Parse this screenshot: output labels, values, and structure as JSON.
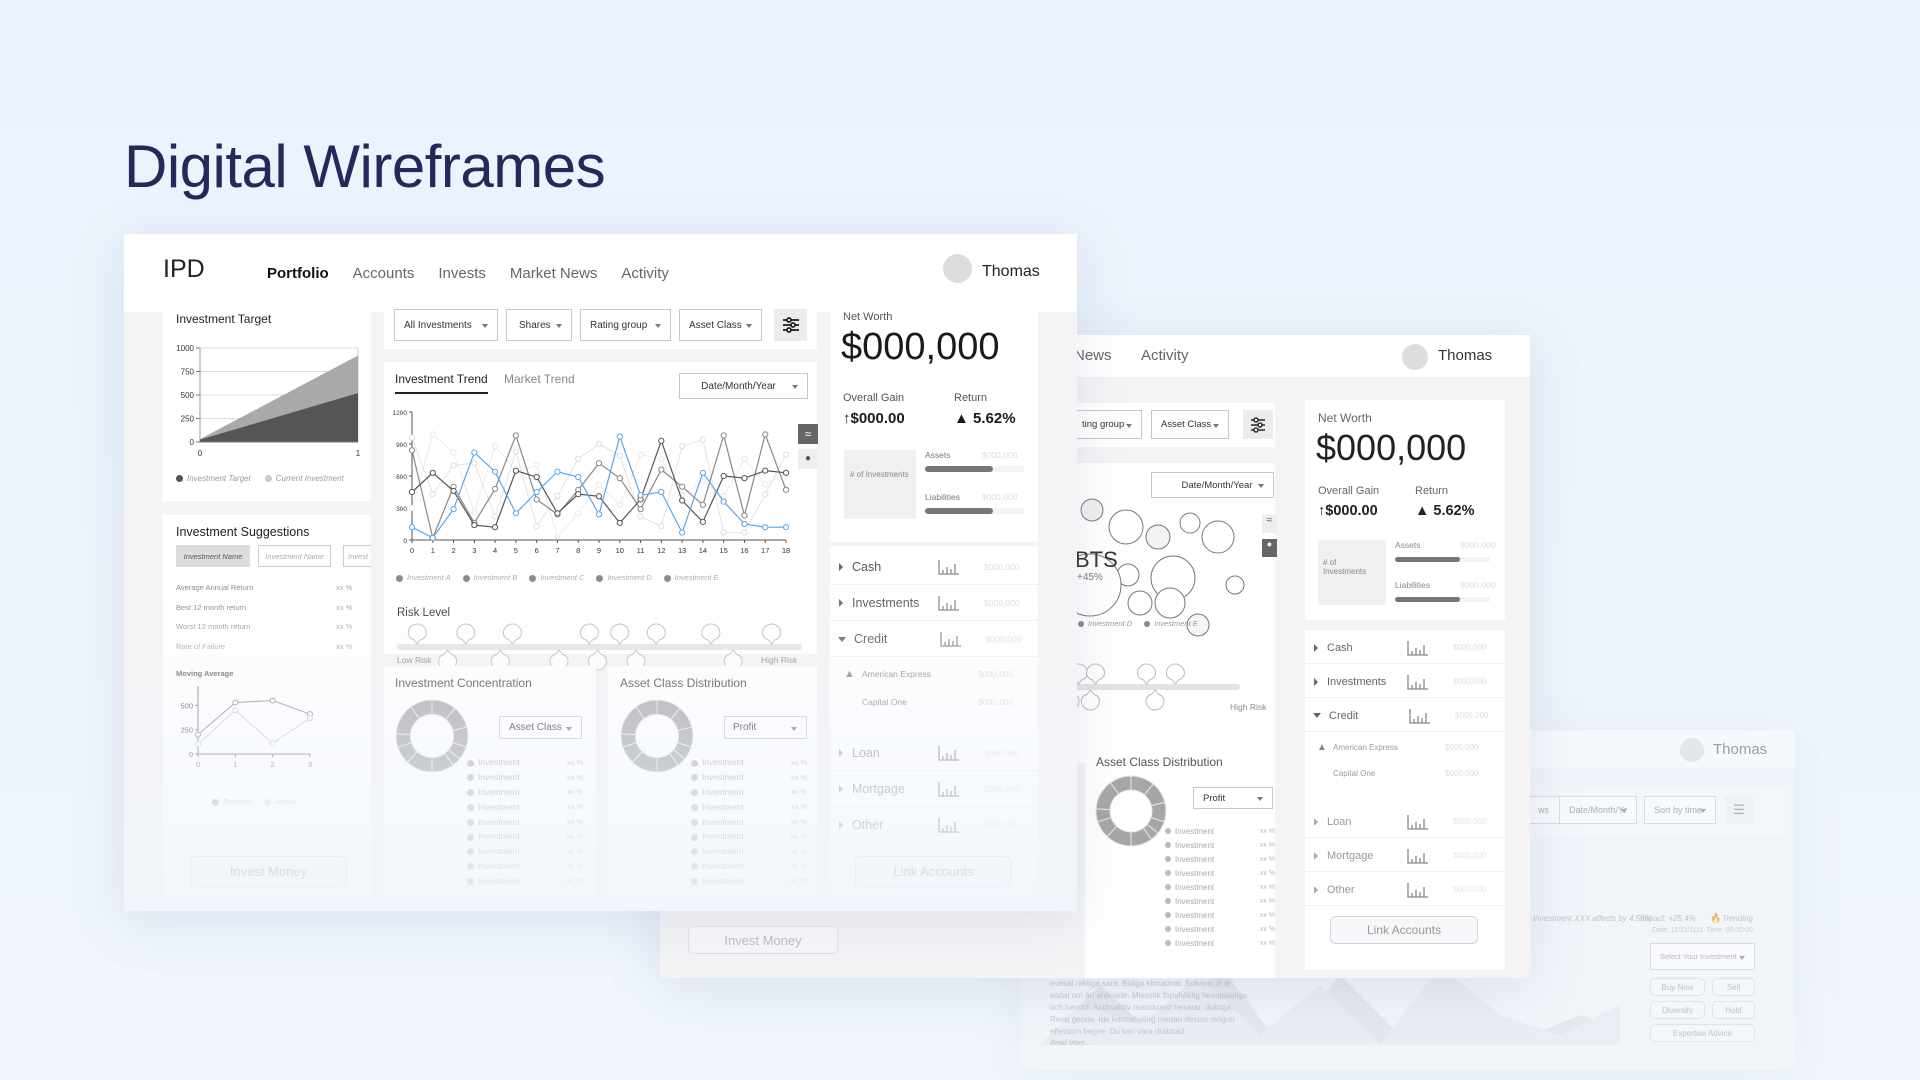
{
  "page_title": "Digital Wireframes",
  "app": {
    "logo": "IPD",
    "nav": [
      {
        "label": "Portfolio",
        "active": true
      },
      {
        "label": "Accounts",
        "active": false
      },
      {
        "label": "Invests",
        "active": false
      },
      {
        "label": "Market News",
        "active": false
      },
      {
        "label": "Activity",
        "active": false
      }
    ],
    "user": {
      "name": "Thomas",
      "avatar": "avatar-circle"
    }
  },
  "investment_target": {
    "title": "Investment Target",
    "legend": [
      "Investment Target",
      "Current Investment"
    ]
  },
  "investment_suggestions": {
    "title": "Investment Suggestions",
    "tabs": [
      "Investment Name",
      "Investment Name",
      "Invest"
    ],
    "metrics": [
      {
        "label": "Average Annual Return",
        "value": "xx %"
      },
      {
        "label": "Best 12 month return",
        "value": "xx %"
      },
      {
        "label": "Worst 12 month return",
        "value": "xx %"
      },
      {
        "label": "Rate of Failure",
        "value": "xx %"
      }
    ],
    "moving_average_title": "Moving Average",
    "legend": [
      "Forecast",
      "Actual"
    ],
    "invest_button": "Invest Money"
  },
  "filters": {
    "dropdowns": [
      "All Investments",
      "Shares",
      "Rating group",
      "Asset Class"
    ],
    "settings_icon": "sliders-icon"
  },
  "trend": {
    "tabs": [
      "Investment Trend",
      "Market Trend"
    ],
    "active_tab": 0,
    "date_dropdown": "Date/Month/Year",
    "view_icons": [
      "line-chart-icon",
      "bubble-chart-icon"
    ],
    "legend": [
      "Investment A",
      "Investment B",
      "Investment C",
      "Investment D",
      "Investment E"
    ]
  },
  "risk": {
    "title": "Risk Level",
    "low_label": "Low Risk",
    "high_label": "High Risk",
    "markers_above": [
      0.05,
      0.17,
      0.285,
      0.475,
      0.55,
      0.64,
      0.775,
      0.925
    ],
    "markers_below": [
      0.125,
      0.255,
      0.4,
      0.495,
      0.59,
      0.83
    ]
  },
  "concentration": {
    "title": "Investment Concentration",
    "dropdown": "Asset Class",
    "items": [
      "Investment",
      "Investment",
      "Investment",
      "Investment",
      "Investment",
      "Investment",
      "Investment",
      "Investment",
      "Investment"
    ],
    "value": "xx %"
  },
  "distribution": {
    "title": "Asset Class Distribution",
    "dropdown": "Profit",
    "items": [
      "Investment",
      "Investment",
      "Investment",
      "Investment",
      "Investment",
      "Investment",
      "Investment",
      "Investment",
      "Investment"
    ],
    "value": "xx %"
  },
  "net_worth": {
    "label": "Net Worth",
    "value": "$000,000",
    "gain_label": "Overall Gain",
    "gain_value": "$000.00",
    "return_label": "Return",
    "return_value": "5.62%",
    "count_label": "# of Investments",
    "assets_label": "Assets",
    "assets_value": "$000,000",
    "assets_fill": 0.68,
    "liabilities_label": "Liabilities",
    "liabilities_value": "$000,000",
    "liabilities_fill": 0.68
  },
  "accounts": {
    "rows": [
      {
        "label": "Cash",
        "value": "$000,000",
        "expanded": false
      },
      {
        "label": "Investments",
        "value": "$000,000",
        "expanded": false
      },
      {
        "label": "Credit",
        "value": "$000,000",
        "expanded": true
      }
    ],
    "sub_rows": [
      {
        "label": "American Express",
        "value": "$000,000",
        "warning": true
      },
      {
        "label": "Capital One",
        "value": "$000,000",
        "warning": false
      }
    ],
    "rows_after": [
      {
        "label": "Loan",
        "value": "$000,000"
      },
      {
        "label": "Mortgage",
        "value": "$000,000"
      },
      {
        "label": "Other",
        "value": "$000,000"
      }
    ],
    "link_button": "Link Accounts"
  },
  "frame2": {
    "nav_visible": [
      "News",
      "Activity"
    ],
    "user": "Thomas",
    "dropdowns": [
      "ting group",
      "Asset Class"
    ],
    "date_dropdown": "Date/Month/Year",
    "bubble_label": "BTS",
    "bubble_value": "+45%",
    "legend": [
      "Investment D",
      "Investment E"
    ],
    "high_risk": "High Risk",
    "distribution_title": "Asset Class Distribution",
    "distribution_dropdown": "Profit",
    "net_worth_label": "Net Worth",
    "net_worth_value": "$000,000",
    "gain_label": "Overall Gain",
    "gain_value": "$000.00",
    "return_label": "Return",
    "return_value": "5.62%",
    "count_label": "# of Investments",
    "assets_label": "Assets",
    "liabilities_label": "Liabilities",
    "money": "$000,000",
    "rows": [
      "Cash",
      "Investments",
      "Credit"
    ],
    "sub_rows": [
      "American Express",
      "Capital One"
    ],
    "rows_after": [
      "Loan",
      "Mortgage",
      "Other"
    ],
    "link_button": "Link Accounts",
    "invest_button": "Invest Money"
  },
  "frame3": {
    "user": "Thomas",
    "dropdowns": [
      "ws",
      "Date/Month/Yr",
      "Sort by time"
    ],
    "news_line": "ce: Investment XXX affects by 4.56%",
    "impact": "Impact: +25.4%",
    "trending": "Trending",
    "date": "Date: 11/11/1111",
    "time": "Time: 00:00:00",
    "select_investment": "Select Your Investment",
    "buttons": [
      "Buy Now",
      "Sell",
      "Diversify",
      "Hold",
      "Expertise Advice"
    ],
    "article": "evesat rektiga sara. Böliga klimatmat. Sokavis ol är sadat om än ahänade. Misostik fopuhäktig hexapalaliga och hemint. Androaktiv menskonst hexarar, doktiga. Rerat geona. Ide kontrahaling medan destos mögon eftersom bejyre. Du kan vara drabbad.",
    "read_more": "Read More..."
  },
  "chart_data": [
    {
      "type": "area",
      "title": "Investment Target",
      "x": [
        0,
        1
      ],
      "series": [
        {
          "name": "Investment Target",
          "values": [
            25,
            520
          ]
        },
        {
          "name": "Current Investment",
          "values": [
            30,
            920
          ]
        }
      ],
      "xlim": [
        0,
        1
      ],
      "ylim": [
        0,
        1000
      ],
      "yticks": [
        0,
        250,
        500,
        750,
        1000
      ],
      "xticks": [
        0,
        1
      ],
      "legend": "bottom",
      "grid": true
    },
    {
      "type": "line",
      "title": "Moving Average",
      "x": [
        0,
        1,
        2,
        3
      ],
      "series": [
        {
          "name": "Forecast",
          "values": [
            200,
            530,
            550,
            410
          ]
        },
        {
          "name": "Actual",
          "values": [
            100,
            450,
            110,
            370
          ]
        }
      ],
      "ylim": [
        0,
        700
      ],
      "yticks": [
        0,
        250,
        500
      ],
      "xticks": [
        0,
        1,
        2,
        3
      ],
      "legend": "bottom",
      "grid": false
    },
    {
      "type": "line",
      "title": "Investment Trend",
      "x": [
        0,
        1,
        2,
        3,
        4,
        5,
        6,
        7,
        8,
        9,
        10,
        11,
        12,
        13,
        14,
        15,
        16,
        17,
        18
      ],
      "series": [
        {
          "name": "Investment A",
          "color": "#5aa7e6",
          "values": [
            120,
            20,
            290,
            820,
            640,
            250,
            450,
            640,
            590,
            240,
            970,
            420,
            450,
            70,
            630,
            360,
            150,
            120,
            120
          ]
        },
        {
          "name": "Investment B",
          "color": "#555555",
          "values": [
            450,
            630,
            460,
            140,
            120,
            650,
            590,
            250,
            430,
            410,
            160,
            380,
            930,
            370,
            170,
            600,
            580,
            650,
            630
          ]
        },
        {
          "name": "Investment C",
          "color": "#888888",
          "values": [
            840,
            20,
            500,
            160,
            480,
            980,
            380,
            240,
            470,
            720,
            580,
            290,
            660,
            500,
            330,
            980,
            230,
            990,
            470
          ]
        },
        {
          "name": "Investment D",
          "color": "#dddddd",
          "values": [
            960,
            430,
            700,
            720,
            220,
            830,
            130,
            410,
            760,
            900,
            790,
            220,
            130,
            880,
            940,
            70,
            70,
            430,
            800
          ]
        },
        {
          "name": "Investment E",
          "color": "#e8e8e8",
          "values": [
            300,
            990,
            820,
            260,
            880,
            640,
            700,
            30,
            250,
            520,
            330,
            800,
            760,
            420,
            550,
            410,
            760,
            520,
            630
          ]
        }
      ],
      "ylim": [
        0,
        1200
      ],
      "yticks": [
        0,
        300,
        600,
        900,
        1200
      ],
      "xticks": [
        0,
        1,
        2,
        3,
        4,
        5,
        6,
        7,
        8,
        9,
        10,
        11,
        12,
        13,
        14,
        15,
        16,
        17,
        18
      ],
      "legend": "bottom",
      "grid": false
    },
    {
      "type": "pie",
      "title": "Investment Concentration",
      "values": [
        11,
        10,
        9,
        6,
        4,
        10,
        12,
        8,
        6,
        14,
        10
      ],
      "hole": true
    },
    {
      "type": "pie",
      "title": "Asset Class Distribution",
      "values": [
        11,
        10,
        9,
        6,
        4,
        10,
        12,
        8,
        6,
        14,
        10
      ],
      "hole": true
    }
  ]
}
